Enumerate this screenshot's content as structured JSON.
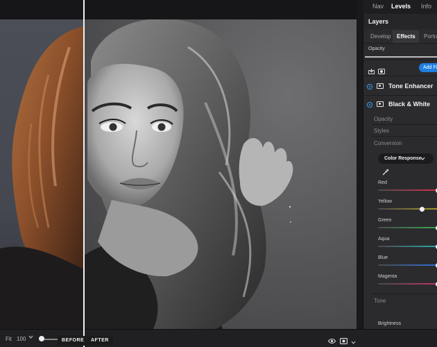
{
  "topnav": {
    "tabs": [
      "Nav",
      "Levels",
      "Info"
    ],
    "active": "Levels"
  },
  "layers": {
    "title": "Layers",
    "subtabs": [
      "Develop",
      "Effects",
      "Portrait"
    ],
    "active_subtab": "Effects",
    "opacity_label": "Opacity",
    "add_filter_label": "Add Filter",
    "items": [
      {
        "name": "Tone Enhancer"
      },
      {
        "name": "Black & White"
      }
    ]
  },
  "black_white": {
    "sections": [
      "Opacity",
      "Styles",
      "Conversion"
    ],
    "conversion_mode": "Color Response",
    "channels": [
      {
        "name": "Red",
        "color": "#d6304a",
        "level": 1.0
      },
      {
        "name": "Yellow",
        "color": "#a89a2a",
        "level": 0.74
      },
      {
        "name": "Green",
        "color": "#3aa84a",
        "level": 1.0
      },
      {
        "name": "Aqua",
        "color": "#2aa8a8",
        "level": 1.0
      },
      {
        "name": "Blue",
        "color": "#2f6fd6",
        "level": 1.0
      },
      {
        "name": "Magenta",
        "color": "#c0336a",
        "level": 1.0
      }
    ],
    "tone_label": "Tone",
    "brightness_label": "Brightness"
  },
  "bottombar": {
    "fit_label": "Fit",
    "zoom_value": "100",
    "zoom_slider_level": 0.05,
    "before_label": "BEFORE",
    "after_label": "AFTER"
  },
  "colors": {
    "accent": "#1f7fe0",
    "panel_bg": "#2b2b2e"
  }
}
